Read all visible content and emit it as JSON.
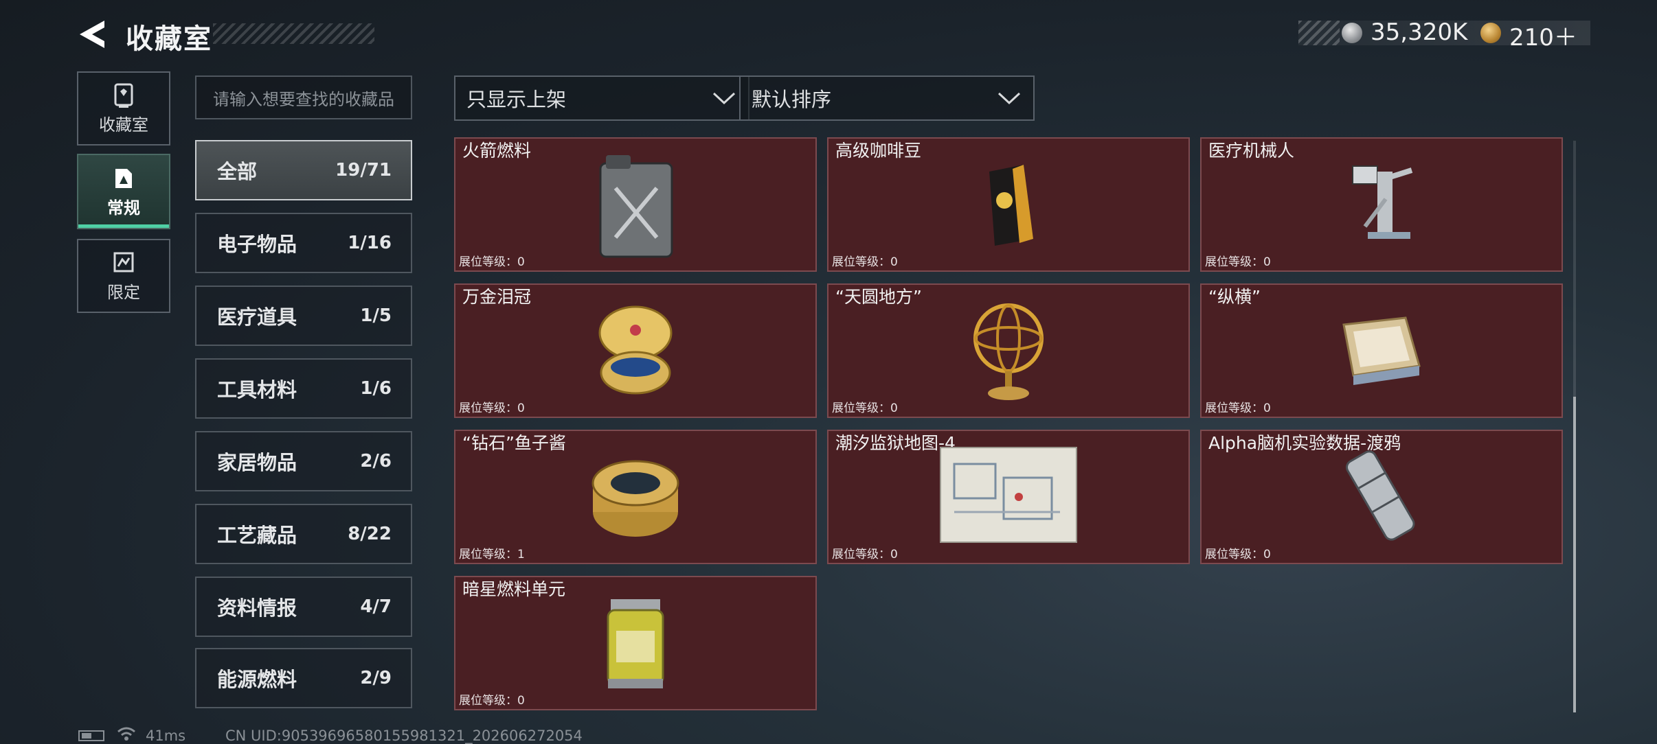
{
  "header": {
    "title": "收藏室",
    "currency_primary": "35,320K",
    "currency_secondary": "210＋"
  },
  "nav": [
    {
      "label": "收藏室",
      "icon": "collection-icon"
    },
    {
      "label": "常规",
      "icon": "regular-icon",
      "selected": true
    },
    {
      "label": "限定",
      "icon": "limited-icon"
    }
  ],
  "search": {
    "placeholder": "请输入想要查找的收藏品"
  },
  "categories": [
    {
      "name": "全部",
      "count": "19/71",
      "selected": true
    },
    {
      "name": "电子物品",
      "count": "1/16"
    },
    {
      "name": "医疗道具",
      "count": "1/5"
    },
    {
      "name": "工具材料",
      "count": "1/6"
    },
    {
      "name": "家居物品",
      "count": "2/6"
    },
    {
      "name": "工艺藏品",
      "count": "8/22"
    },
    {
      "name": "资料情报",
      "count": "4/7"
    },
    {
      "name": "能源燃料",
      "count": "2/9"
    }
  ],
  "filters": {
    "display_filter": "只显示上架",
    "sort_order": "默认排序"
  },
  "items": [
    {
      "name": "火箭燃料",
      "level": "展位等级：0"
    },
    {
      "name": "高级咖啡豆",
      "level": "展位等级：0"
    },
    {
      "name": "医疗机械人",
      "level": "展位等级：0"
    },
    {
      "name": "万金泪冠",
      "level": "展位等级：0"
    },
    {
      "name": "“天圆地方”",
      "level": "展位等级：0"
    },
    {
      "name": "“纵横”",
      "level": "展位等级：0"
    },
    {
      "name": "“钻石”鱼子酱",
      "level": "展位等级：1"
    },
    {
      "name": "潮汐监狱地图-4",
      "level": "展位等级：0"
    },
    {
      "name": "Alpha脑机实验数据-渡鸦",
      "level": "展位等级：0"
    },
    {
      "name": "暗星燃料单元",
      "level": "展位等级：0"
    }
  ],
  "status_bar": {
    "ping": "41ms",
    "uid": "CN UID:9053969658015598132​1_202606272054"
  },
  "colors": {
    "card_bg": "#4a1f23",
    "selected_nav_accent": "#4fd0a5"
  }
}
